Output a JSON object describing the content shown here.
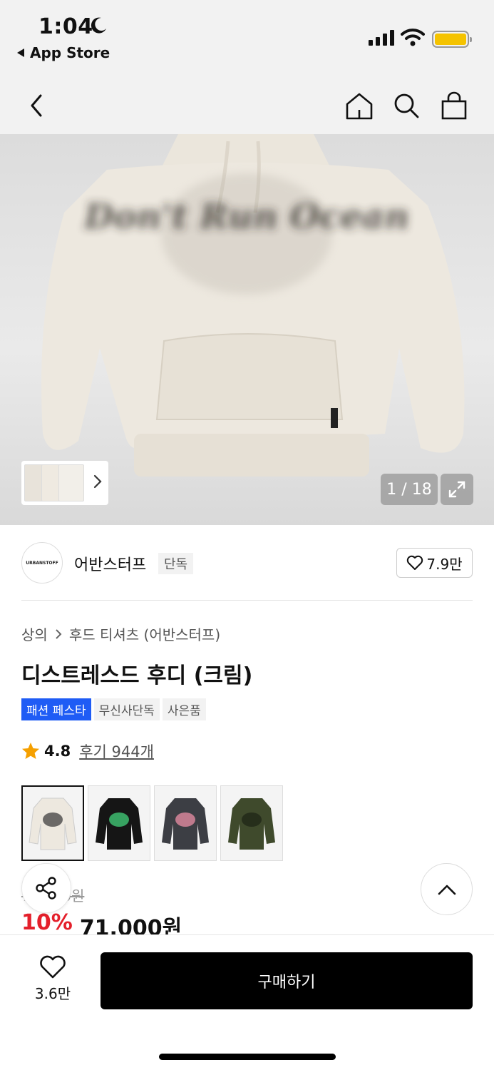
{
  "status_bar": {
    "time": "1:04",
    "back_app": "App Store"
  },
  "gallery": {
    "counter": "1 / 18",
    "hoodie_print": "Don't Run Ocean"
  },
  "brand": {
    "logo_text": "URBANSTOFF",
    "name": "어반스터프",
    "tag": "단독",
    "likes": "7.9만"
  },
  "breadcrumb": {
    "category": "상의",
    "subcategory": "후드 티셔츠 (어반스터프)"
  },
  "product": {
    "title": "디스트레스드 후디 (크림)",
    "badges": [
      "패션 페스타",
      "무신사단독",
      "사은품"
    ],
    "rating": "4.8",
    "reviews": "후기 944개"
  },
  "color_options": [
    {
      "name": "cream",
      "color": "#ede8df"
    },
    {
      "name": "black-green",
      "color": "#151515"
    },
    {
      "name": "charcoal",
      "color": "#3c3e44"
    },
    {
      "name": "olive",
      "color": "#3f4a2c"
    }
  ],
  "price": {
    "original": "79,000원",
    "discount": "10%",
    "sale": "71,000원"
  },
  "bottom": {
    "wish_count": "3.6만",
    "buy_label": "구매하기"
  }
}
